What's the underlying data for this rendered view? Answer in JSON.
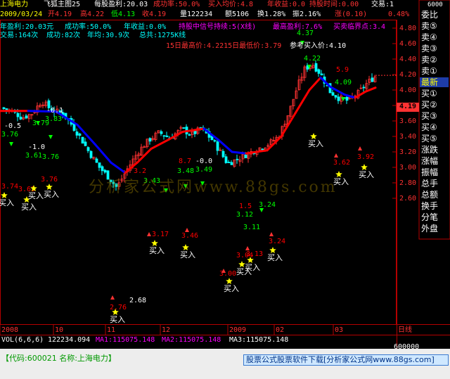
{
  "header": {
    "stock_name": "上海电力",
    "formula_name": "飞狐主图25",
    "eps": "每股盈利:20.03",
    "success_rate": "成功率:50.0%",
    "buy_avg": "买入均价:4.8",
    "annual_gain": "年收益:0.0",
    "hold_time": "持股时间:0.00",
    "trade_label": "交易:1"
  },
  "info_row": {
    "date": "2009/03/24",
    "open": "开4.19",
    "high": "高4.22",
    "low": "低4.13",
    "close": "收4.19",
    "volume": "量122234",
    "amount": "额5106",
    "turnover": "换1.28%",
    "amplitude": "振2.16%",
    "change": "涨(0.10)",
    "pct": "0.48%"
  },
  "stats_row1": {
    "annual_profit": "年盈利:20.03元",
    "success_rate": "成功率:50.0%",
    "annual_gain": "年收益:0.0%",
    "hold_signal": "持股中信号持续:5(X线)",
    "max_profit": "最高盈利:7.6%",
    "buy_sell_point": "买卖临界点:3.4"
  },
  "stats_row2": {
    "trades": "交易:164次",
    "success": "成功:82次",
    "annual_count": "年均:30.9次",
    "total": "总共:1275K线"
  },
  "range_info": "15日最高价:4.2215日最低价:3.79",
  "ref_buy": "参考买入价:4.10",
  "price_tag": "4.19",
  "y_axis": {
    "ticks": [
      "4.80",
      "4.60",
      "4.40",
      "4.20",
      "4.00",
      "3.80",
      "3.60",
      "3.40",
      "3.20",
      "3.00",
      "2.80",
      "2.60"
    ],
    "values": [
      4.8,
      4.6,
      4.4,
      4.2,
      4.0,
      3.8,
      3.6,
      3.4,
      3.2,
      3.0,
      2.8,
      2.6
    ]
  },
  "x_axis": {
    "labels": [
      "2008",
      "10",
      "11",
      "12",
      "2009",
      "02",
      "03"
    ],
    "mode_label": "日线"
  },
  "sidebar": {
    "items": [
      "委比",
      "卖⑤",
      "卖④",
      "卖③",
      "卖②",
      "卖①",
      "最新",
      "买①",
      "买②",
      "买③",
      "买④",
      "买⑤",
      "涨跌",
      "涨幅",
      "振幅",
      "总手",
      "总额",
      "换手",
      "分笔",
      "外盘"
    ],
    "top_label": "6000"
  },
  "price_labels": [
    {
      "text": "-0.5",
      "color": "#ffffff"
    },
    {
      "text": "3.76",
      "color": "#00ff00"
    },
    {
      "text": "-0.1",
      "color": "#ffffff"
    },
    {
      "text": "3.83",
      "color": "#00ff00"
    },
    {
      "text": "3.79",
      "color": "#00ff00"
    },
    {
      "text": "-1.0",
      "color": "#ffffff"
    },
    {
      "text": "3.61",
      "color": "#00ff00"
    },
    {
      "text": "3.76",
      "color": "#00ff00"
    },
    {
      "text": "3.2",
      "color": "#ff0000"
    },
    {
      "text": "3.43",
      "color": "#00ff00"
    },
    {
      "text": "8.7",
      "color": "#ff0000"
    },
    {
      "text": "3.48",
      "color": "#00ff00"
    },
    {
      "text": "-0.0",
      "color": "#ffffff"
    },
    {
      "text": "3.49",
      "color": "#00ff00"
    },
    {
      "text": "1.5",
      "color": "#ff0000"
    },
    {
      "text": "3.24",
      "color": "#00ff00"
    },
    {
      "text": "3.12",
      "color": "#00ff00"
    },
    {
      "text": "3.11",
      "color": "#00ff00"
    },
    {
      "text": "4.37",
      "color": "#00ff00"
    },
    {
      "text": "4.22",
      "color": "#00ff00"
    },
    {
      "text": "5.9",
      "color": "#ff0000"
    },
    {
      "text": "4.09",
      "color": "#00ff00"
    },
    {
      "text": "2.68",
      "color": "#ffffff"
    },
    {
      "text": "2.76",
      "color": "#ff0000"
    },
    {
      "text": "3.17",
      "color": "#ff0000"
    },
    {
      "text": "3.46",
      "color": "#ff0000"
    },
    {
      "text": "3.00",
      "color": "#ff0000"
    },
    {
      "text": "3.04",
      "color": "#ff0000"
    },
    {
      "text": "3.13",
      "color": "#ff0000"
    },
    {
      "text": "3.24",
      "color": "#ff0000"
    },
    {
      "text": "3.62",
      "color": "#ff0000"
    },
    {
      "text": "3.92",
      "color": "#ff0000"
    },
    {
      "text": "3.74",
      "color": "#ff0000"
    },
    {
      "text": "3.63",
      "color": "#ff0000"
    },
    {
      "text": "3.76",
      "color": "#ff0000"
    }
  ],
  "buy_label": "买入",
  "volume_bar": {
    "vol": "VOL(6,6,6)",
    "vol_value": "122234.094",
    "ma1": "MA1:115075.148",
    "ma2": "MA2:115075.148",
    "ma3": "MA3:115075.148",
    "axis": "600000"
  },
  "footer": {
    "code": "【代码:600021 名称:上海电力】",
    "ad": "股票公式股票软件下载[分析家公式网www.88gs.com]"
  },
  "watermark": "分析家公式网www.88gs.com",
  "colors": {
    "up": "#ff3232",
    "down": "#00ffff",
    "ma_up": "#ff0000",
    "ma_down": "#0000ff",
    "axis": "#b40000",
    "yellow": "#ffff00"
  }
}
